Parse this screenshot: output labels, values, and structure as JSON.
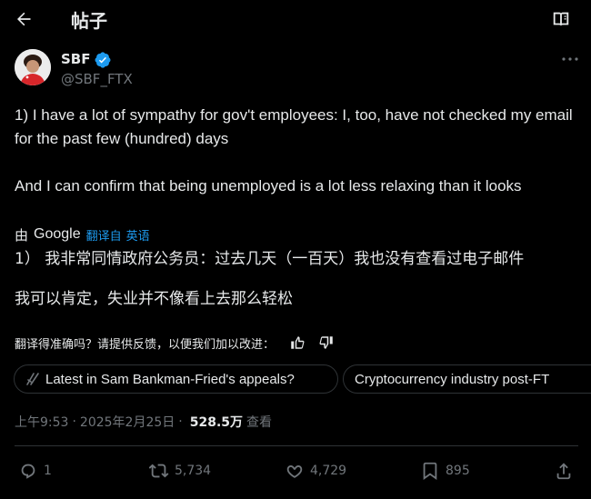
{
  "header": {
    "title": "帖子",
    "back_icon": "arrow-left-icon",
    "reader_icon": "book-open-icon"
  },
  "author": {
    "name": "SBF",
    "handle": "@SBF_FTX",
    "verified": true,
    "verified_color": "#1d9bf0"
  },
  "tweet": {
    "line1": "1) I have a lot of sympathy for gov't employees: I, too, have not checked my email for the past few (hundred) days",
    "line2": "And I can confirm that being unemployed is a lot less relaxing than it looks"
  },
  "translation": {
    "by_label": "由",
    "provider": "Google",
    "from_label": "翻译自",
    "language": "英语",
    "line1": "1） 我非常同情政府公务员：过去几天（一百天）我也没有查看过电子邮件",
    "line2": "我可以肯定，失业并不像看上去那么轻松",
    "feedback_prompt": "翻译得准确吗？请提供反馈，以便我们加以改进："
  },
  "grok_chips": [
    {
      "label": "Latest in Sam Bankman-Fried's appeals?"
    },
    {
      "label": "Cryptocurrency industry post-FT"
    }
  ],
  "meta": {
    "time": "上午9:53",
    "separator": "·",
    "date": "2025年2月25日",
    "views_count": "528.5万",
    "views_label": "查看"
  },
  "actions": {
    "replies": "1",
    "reposts": "5,734",
    "likes": "4,729",
    "bookmarks": "895"
  },
  "colors": {
    "background": "#000000",
    "text": "#e7e9ea",
    "muted": "#71767b",
    "accent": "#1d9bf0",
    "border": "#2f3336"
  }
}
